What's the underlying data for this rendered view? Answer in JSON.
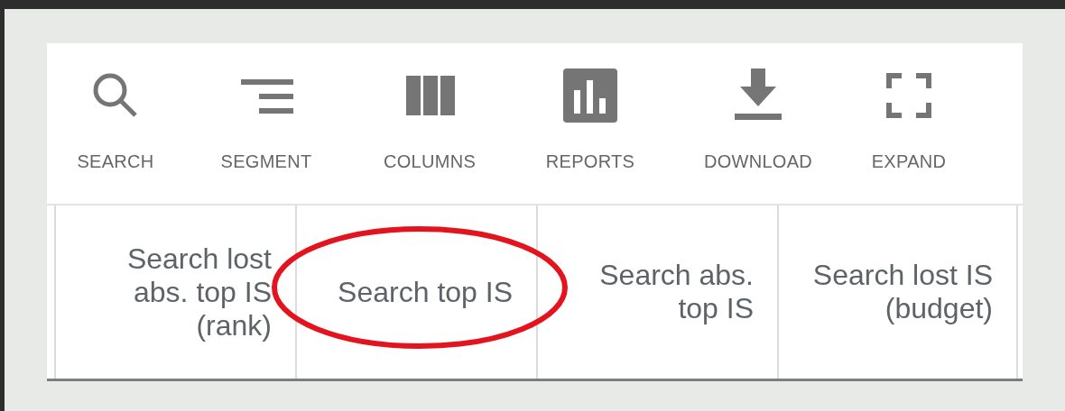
{
  "toolbar": [
    {
      "kind": "search",
      "label": "SEARCH"
    },
    {
      "kind": "segment",
      "label": "SEGMENT"
    },
    {
      "kind": "columns",
      "label": "COLUMNS"
    },
    {
      "kind": "reports",
      "label": "REPORTS"
    },
    {
      "kind": "download",
      "label": "DOWNLOAD"
    },
    {
      "kind": "expand",
      "label": "EXPAND"
    }
  ],
  "table": {
    "columns": [
      {
        "label": "Search lost abs. top IS (rank)",
        "highlighted": false
      },
      {
        "label": "Search top IS",
        "highlighted": true
      },
      {
        "label": "Search abs. top IS",
        "highlighted": false
      },
      {
        "label": "Search lost IS (budget)",
        "highlighted": false
      }
    ]
  }
}
